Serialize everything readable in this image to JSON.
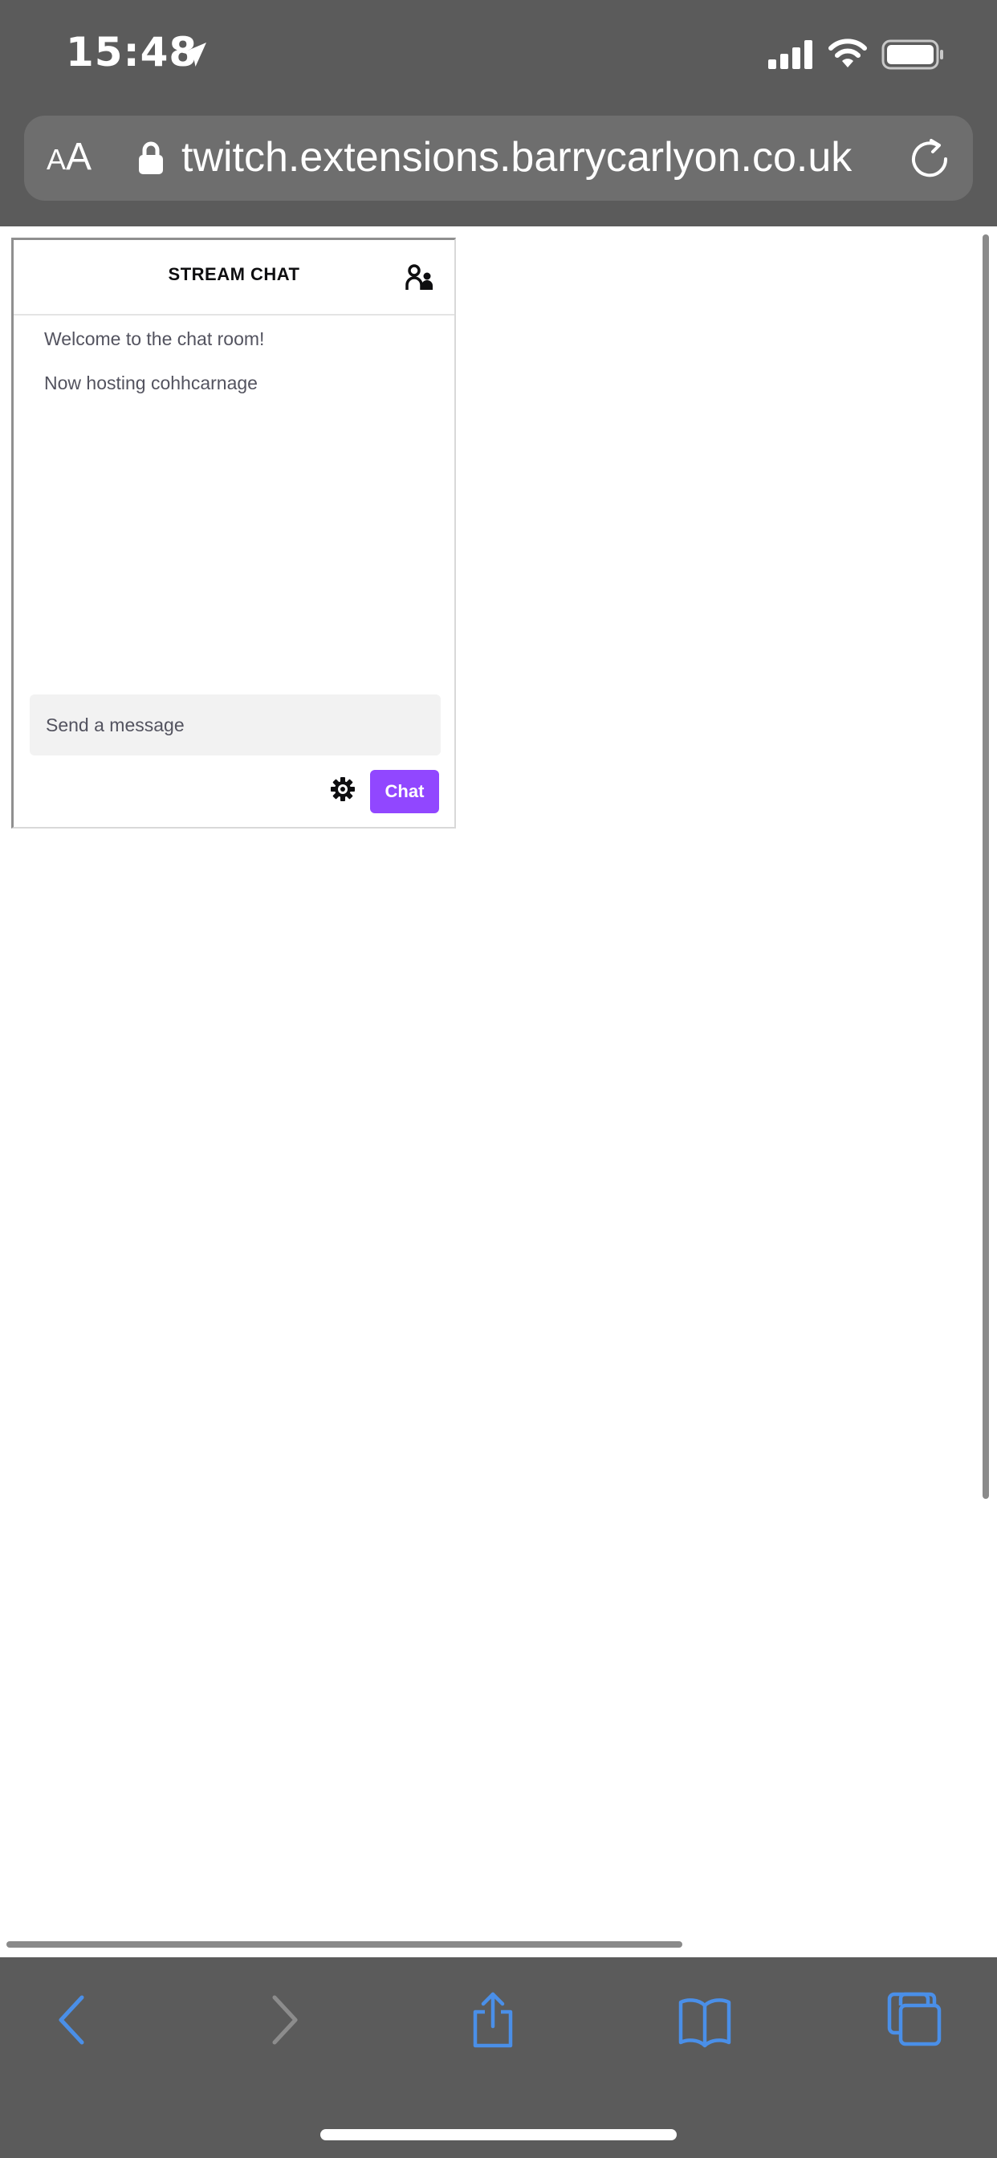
{
  "status_bar": {
    "time": "15:48"
  },
  "browser": {
    "text_size_label_small": "A",
    "text_size_label_large": "A",
    "url": "twitch.extensions.barrycarlyon.co.uk"
  },
  "chat": {
    "title": "STREAM CHAT",
    "messages": [
      "Welcome to the chat room!",
      "Now hosting cohhcarnage"
    ],
    "input_placeholder": "Send a message",
    "send_label": "Chat"
  },
  "colors": {
    "accent": "#9147ff",
    "safari_link_blue": "#4a8fe8",
    "chrome_gray": "#5b5b5b"
  },
  "icons": {
    "location": "location-arrow-icon",
    "signal": "cellular-signal-icon",
    "wifi": "wifi-icon",
    "battery": "battery-icon",
    "lock": "lock-icon",
    "reload": "reload-icon",
    "users": "users-icon",
    "settings": "gear-icon",
    "back": "chevron-left-icon",
    "forward": "chevron-right-icon",
    "share": "share-icon",
    "bookmarks": "book-icon",
    "tabs": "tabs-icon"
  }
}
